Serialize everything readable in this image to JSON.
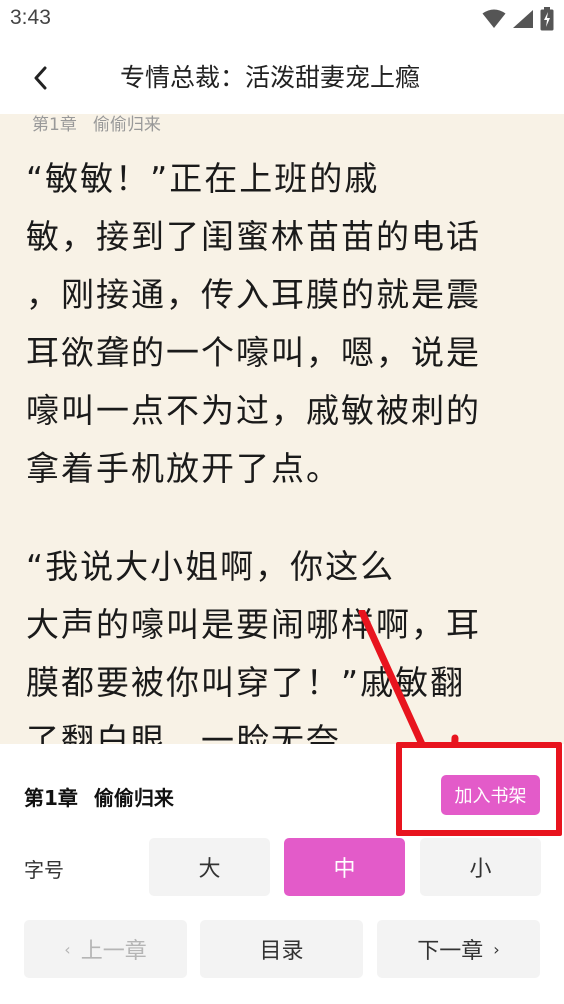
{
  "status_bar": {
    "time": "3:43"
  },
  "header": {
    "title": "专情总裁：活泼甜妻宠上瘾"
  },
  "chapter": {
    "number": "第1章",
    "name": "偷偷归来"
  },
  "content": {
    "paragraph_1": [
      "“敏敏！”正在上班的戚",
      "敏，接到了闺蜜林苗苗的电话",
      "，刚接通，传入耳膜的就是震",
      "耳欲聋的一个嚎叫，嗯，说是",
      "嚎叫一点不为过，戚敏被刺的",
      "拿着手机放开了点。"
    ],
    "paragraph_2": [
      "“我说大小姐啊，你这么",
      "大声的嚎叫是要闹哪样啊，耳",
      "膜都要被你叫穿了！”戚敏翻",
      "了翻白眼，一脸无奈。"
    ]
  },
  "panel": {
    "add_to_bookshelf": "加入书架",
    "font_size_label": "字号",
    "font_sizes": {
      "large": "大",
      "medium": "中",
      "small": "小"
    },
    "active_font_size": "medium",
    "prev_chapter": "上一章",
    "catalog": "目录",
    "next_chapter": "下一章"
  },
  "colors": {
    "accent": "#e35bc9",
    "reading_background": "#f8f2e6",
    "annotation_red": "#e8141e"
  },
  "icons": [
    "wifi-icon",
    "signal-icon",
    "battery-icon",
    "back-chevron-icon",
    "chevron-left-icon",
    "chevron-right-icon"
  ]
}
